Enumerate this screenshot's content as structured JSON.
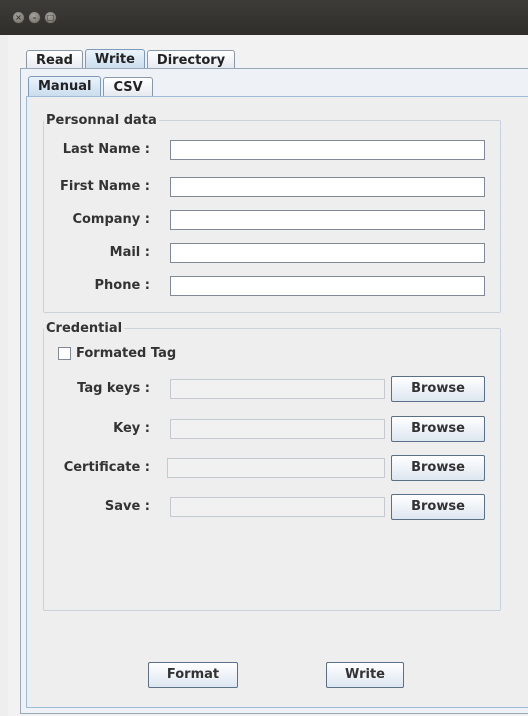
{
  "window": {
    "controls": [
      "close-icon",
      "minimize-icon",
      "maximize-icon"
    ]
  },
  "tabs": [
    {
      "label": "Read",
      "active": false
    },
    {
      "label": "Write",
      "active": true
    },
    {
      "label": "Directory",
      "active": false
    }
  ],
  "subtabs": [
    {
      "label": "Manual",
      "active": true
    },
    {
      "label": "CSV",
      "active": false
    }
  ],
  "personal": {
    "legend": "Personnal data",
    "last_name_label": "Last Name :",
    "last_name_value": "",
    "first_name_label": "First Name :",
    "first_name_value": "",
    "company_label": "Company :",
    "company_value": "",
    "mail_label": "Mail :",
    "mail_value": "",
    "phone_label": "Phone :",
    "phone_value": ""
  },
  "credential": {
    "legend": "Credential",
    "formated_tag_label": "Formated Tag",
    "formated_tag_checked": false,
    "tag_keys_label": "Tag keys :",
    "key_label": "Key :",
    "certificate_label": "Certificate :",
    "save_label": "Save :",
    "browse_label": "Browse"
  },
  "actions": {
    "format_label": "Format",
    "write_label": "Write"
  }
}
